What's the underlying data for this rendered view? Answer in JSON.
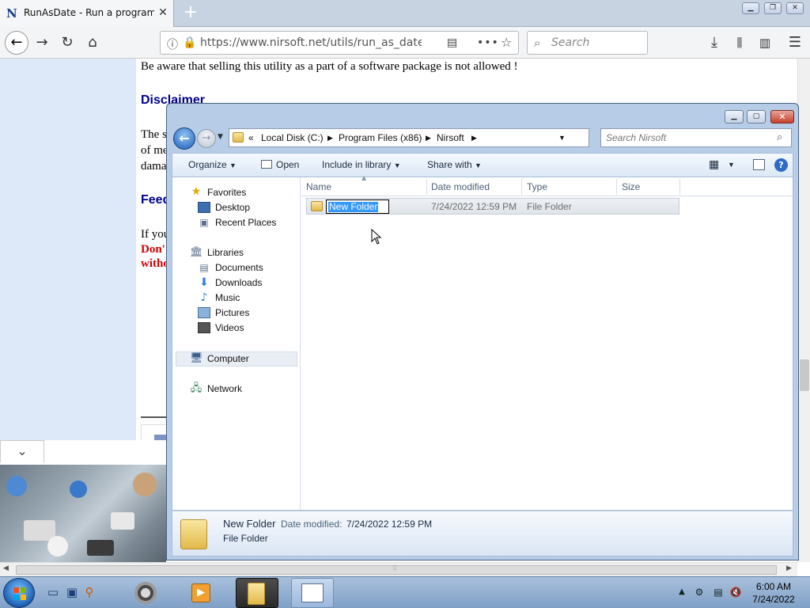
{
  "browser": {
    "tab_title": "RunAsDate - Run a program wi",
    "tab_favicon": "N",
    "url": "https://www.nirsoft.net/utils/run_as_date.htm",
    "search_placeholder": "Search"
  },
  "page": {
    "line1": "Be aware that selling this utility as a part of a software package is not allowed !",
    "heading_disclaimer": "Disclaimer",
    "partial_the": "The s",
    "partial_ofme": "of me",
    "partial_dama": "dama",
    "heading_feed": "Feed",
    "partial_ifyou": "If you",
    "partial_dont": "Don'",
    "partial_with": "witho"
  },
  "explorer": {
    "breadcrumb": [
      "«",
      "Local Disk (C:)",
      "Program Files (x86)",
      "Nirsoft"
    ],
    "search_placeholder": "Search Nirsoft",
    "commands": {
      "organize": "Organize",
      "open": "Open",
      "include": "Include in library",
      "share": "Share with"
    },
    "nav": {
      "favorites": "Favorites",
      "desktop": "Desktop",
      "recent": "Recent Places",
      "libraries": "Libraries",
      "documents": "Documents",
      "downloads": "Downloads",
      "music": "Music",
      "pictures": "Pictures",
      "videos": "Videos",
      "computer": "Computer",
      "network": "Network"
    },
    "columns": {
      "name": "Name",
      "date": "Date modified",
      "type": "Type",
      "size": "Size"
    },
    "row": {
      "name": "New Folder",
      "date": "7/24/2022 12:59 PM",
      "type": "File Folder"
    },
    "details": {
      "name": "New Folder",
      "date_label": "Date modified:",
      "date": "7/24/2022 12:59 PM",
      "type": "File Folder"
    }
  },
  "taskbar": {
    "time": "6:00 AM",
    "date": "7/24/2022"
  },
  "colors": {
    "accent": "#3399ff",
    "heading": "#00008b",
    "warning": "#d00000"
  }
}
